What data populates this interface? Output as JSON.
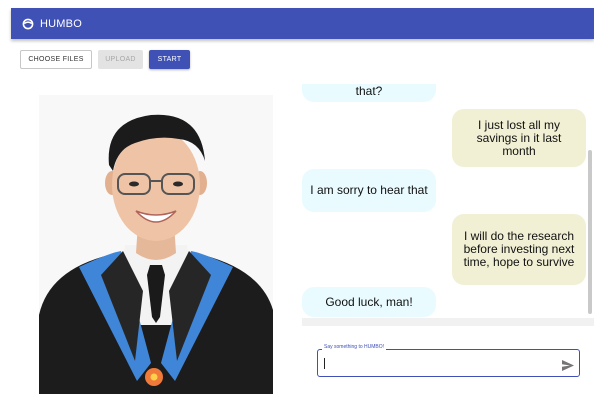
{
  "app": {
    "title": "HUMBO"
  },
  "toolbar": {
    "choose_files_label": "CHOOSE FILES",
    "upload_label": "UPLOAD",
    "start_label": "START"
  },
  "chat": {
    "messages": [
      {
        "sender": "bot",
        "text": "that?"
      },
      {
        "sender": "user",
        "text": "I just lost all my savings in it last month"
      },
      {
        "sender": "bot",
        "text": "I am sorry to hear that"
      },
      {
        "sender": "user",
        "text": "I will do the research before investing next time, hope to survive"
      },
      {
        "sender": "bot",
        "text": "Good luck, man!"
      }
    ]
  },
  "input": {
    "label": "Say something to HUMBO!",
    "value": ""
  },
  "colors": {
    "primary": "#3f51b5",
    "bot_bubble": "#e9fbff",
    "user_bubble": "#f1f0d4"
  }
}
